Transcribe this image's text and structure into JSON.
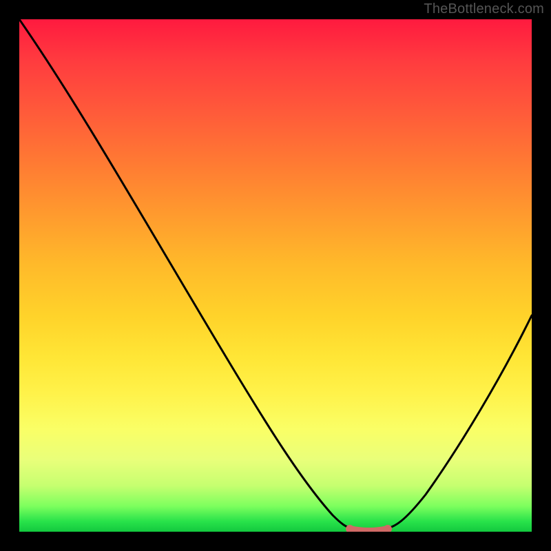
{
  "watermark": "TheBottleneck.com",
  "chart_data": {
    "type": "line",
    "title": "",
    "xlabel": "",
    "ylabel": "",
    "xlim": [
      0,
      100
    ],
    "ylim": [
      0,
      100
    ],
    "series": [
      {
        "name": "bottleneck-curve",
        "x": [
          0,
          5,
          10,
          20,
          30,
          40,
          50,
          57,
          63,
          67,
          72,
          75,
          80,
          85,
          90,
          95,
          100
        ],
        "values": [
          100,
          92,
          84,
          70,
          56,
          42,
          28,
          14,
          4,
          0,
          0,
          2,
          10,
          20,
          30,
          40,
          50
        ]
      }
    ],
    "flat_segment": {
      "x_start": 63,
      "x_end": 72,
      "value": 0,
      "color": "#d06a66"
    },
    "gradient_stops_pct_from_top": [
      {
        "pct": 0,
        "color": "#ff1a3f"
      },
      {
        "pct": 28,
        "color": "#ff7a33"
      },
      {
        "pct": 58,
        "color": "#ffd32a"
      },
      {
        "pct": 80,
        "color": "#faff66"
      },
      {
        "pct": 95,
        "color": "#7dff5e"
      },
      {
        "pct": 100,
        "color": "#13c93e"
      }
    ]
  }
}
